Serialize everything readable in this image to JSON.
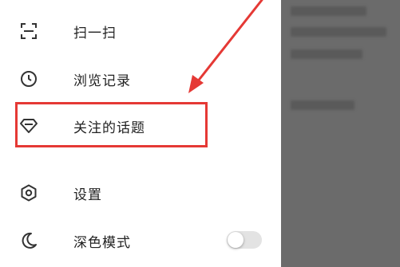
{
  "menu": {
    "items": [
      {
        "label": "扫一扫",
        "icon": "scan-icon"
      },
      {
        "label": "浏览记录",
        "icon": "clock-icon"
      },
      {
        "label": "关注的话题",
        "icon": "diamond-icon"
      },
      {
        "label": "设置",
        "icon": "hexagon-settings-icon"
      },
      {
        "label": "深色模式",
        "icon": "moon-icon"
      }
    ]
  },
  "dark_mode": {
    "enabled": false
  },
  "annotation": {
    "highlight_color": "#e53935",
    "arrow_color": "#e53935"
  }
}
